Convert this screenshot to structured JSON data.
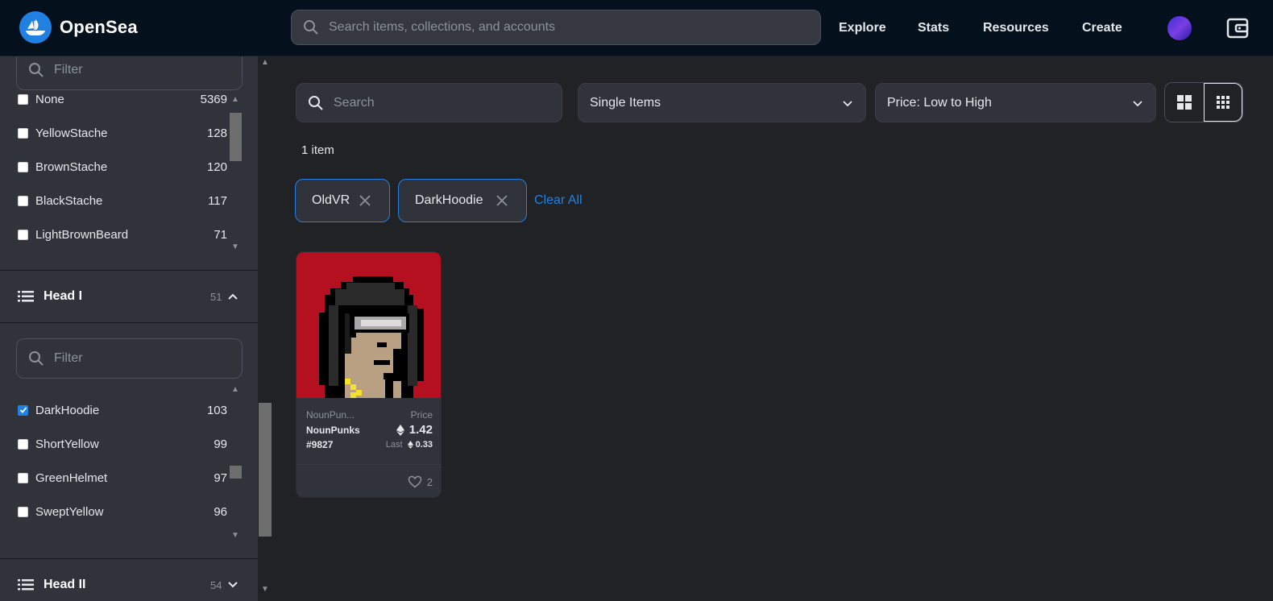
{
  "header": {
    "brand": "OpenSea",
    "search_placeholder": "Search items, collections, and accounts",
    "nav": [
      "Explore",
      "Stats",
      "Resources",
      "Create"
    ]
  },
  "sidebar": {
    "filter_placeholder": "Filter",
    "facial_hair_options": [
      {
        "label": "None",
        "count": "5369",
        "checked": false
      },
      {
        "label": "YellowStache",
        "count": "128",
        "checked": false
      },
      {
        "label": "BrownStache",
        "count": "120",
        "checked": false
      },
      {
        "label": "BlackStache",
        "count": "117",
        "checked": false
      },
      {
        "label": "LightBrownBeard",
        "count": "71",
        "checked": false
      }
    ],
    "head1": {
      "title": "Head I",
      "count": "51",
      "options": [
        {
          "label": "DarkHoodie",
          "count": "103",
          "checked": true
        },
        {
          "label": "ShortYellow",
          "count": "99",
          "checked": false
        },
        {
          "label": "GreenHelmet",
          "count": "97",
          "checked": false
        },
        {
          "label": "SweptYellow",
          "count": "96",
          "checked": false
        }
      ]
    },
    "head2": {
      "title": "Head II",
      "count": "54"
    }
  },
  "main": {
    "search_placeholder": "Search",
    "type_select": "Single Items",
    "sort_select": "Price: Low to High",
    "item_count": "1 item",
    "active_filters": [
      "OldVR",
      "DarkHoodie"
    ],
    "clear_all": "Clear All",
    "card": {
      "collection": "NounPun...",
      "name": "NounPunks #9827",
      "price_label": "Price",
      "price": "1.42",
      "last_label": "Last",
      "last_price": "0.33",
      "likes": "2"
    }
  },
  "colors": {
    "accent": "#2081e2",
    "header_bg": "#04111d",
    "page_bg": "#202225",
    "panel_bg": "#303339",
    "card_image_bg": "#b5101f"
  }
}
